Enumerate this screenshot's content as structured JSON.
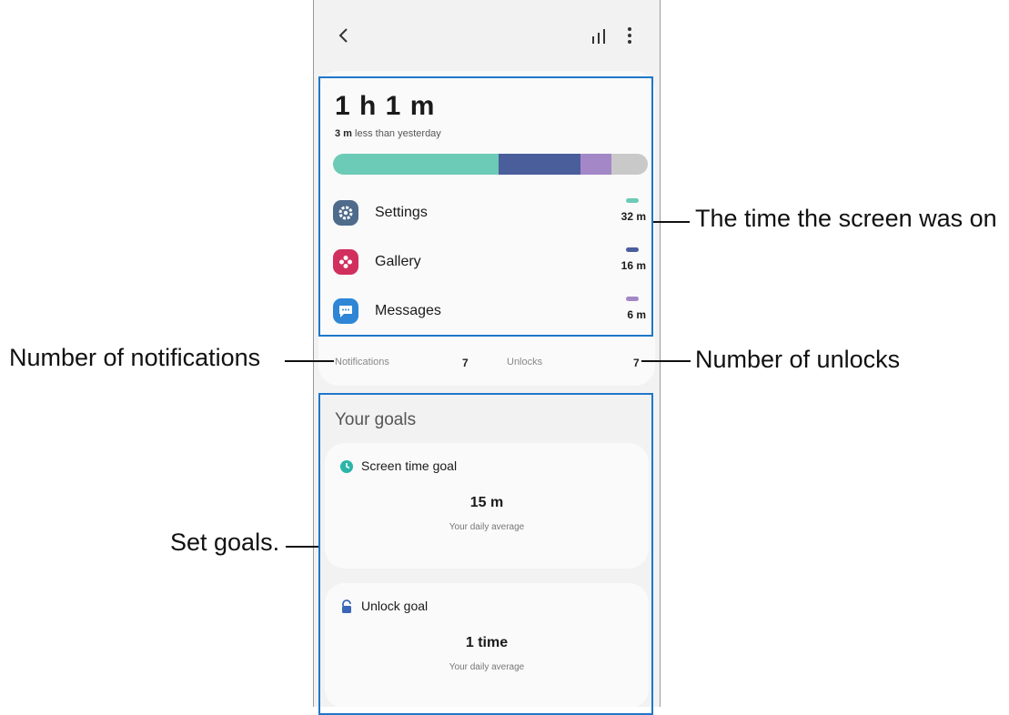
{
  "usage": {
    "total": "1 h 1 m",
    "compare_value": "3 m",
    "compare_text": " less than yesterday",
    "bar_segments": [
      {
        "color": "#6ccbb6",
        "fraction": 0.525
      },
      {
        "color": "#4a5e9c",
        "fraction": 0.26
      },
      {
        "color": "#a387c7",
        "fraction": 0.1
      },
      {
        "color": "#c9c9c9",
        "fraction": 0.115
      }
    ],
    "apps": [
      {
        "name": "Settings",
        "time": "32 m",
        "icon": "gear-icon",
        "icon_bg": "#4f6b8c",
        "dash_color": "#6ccbb6"
      },
      {
        "name": "Gallery",
        "time": "16 m",
        "icon": "flower-icon",
        "icon_bg": "#d1305e",
        "dash_color": "#4a5e9c"
      },
      {
        "name": "Messages",
        "time": "6 m",
        "icon": "chat-icon",
        "icon_bg": "#2f86d6",
        "dash_color": "#a387c7"
      }
    ]
  },
  "counts": {
    "notifications_label": "Notifications",
    "notifications_value": "7",
    "unlocks_label": "Unlocks",
    "unlocks_value": "7"
  },
  "goals": {
    "title": "Your goals",
    "screen_time": {
      "title": "Screen time goal",
      "value": "15 m",
      "subtitle": "Your daily average"
    },
    "unlock": {
      "title": "Unlock goal",
      "value": "1 time",
      "subtitle": "Your daily average"
    }
  },
  "callouts": {
    "screen_on": "The time the screen was on",
    "notifications": "Number of notifications",
    "unlocks": "Number of unlocks",
    "goals": "Set goals."
  },
  "colors": {
    "highlight": "#1f77c9",
    "screen_time_icon": "#2bb5a8",
    "unlock_icon": "#3a66b8"
  }
}
